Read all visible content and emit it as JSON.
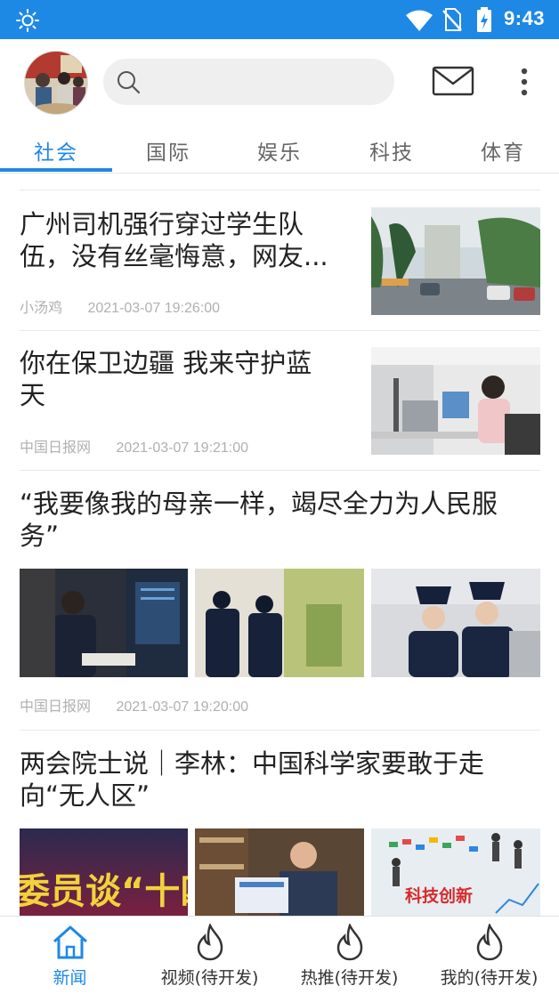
{
  "status_bar": {
    "time": "9:43",
    "icons": [
      "brightness-icon",
      "wifi-icon",
      "no-sim-icon",
      "battery-charging-icon"
    ]
  },
  "header": {
    "search": {
      "placeholder": ""
    },
    "icons": [
      "search-icon",
      "mail-icon",
      "more-vert-icon"
    ]
  },
  "tabs": [
    {
      "label": "社会",
      "active": true
    },
    {
      "label": "国际",
      "active": false
    },
    {
      "label": "娱乐",
      "active": false
    },
    {
      "label": "科技",
      "active": false
    },
    {
      "label": "体育",
      "active": false
    }
  ],
  "articles": [
    {
      "title_line1": "广州司机强行穿过学生队",
      "title_line2": "伍，没有丝毫悔意，网友...",
      "source": "小汤鸡",
      "time": "2021-03-07 19:26:00"
    },
    {
      "title_line1": "你在保卫边疆 我来守护蓝",
      "title_line2": "天",
      "source": "中国日报网",
      "time": "2021-03-07 19:21:00"
    },
    {
      "title_line1": "“我要像我的母亲一样，竭尽全力为人民服",
      "title_line2": "务”",
      "source": "中国日报网",
      "time": "2021-03-07 19:20:00"
    },
    {
      "title_line1": "两会院士说｜李林：中国科学家要敢于走",
      "title_line2": "向“无人区”",
      "image_text_1": "委员谈“十四",
      "image_text_3": "科技创新"
    }
  ],
  "bottom_nav": [
    {
      "label": "新闻",
      "icon": "home-icon",
      "active": true
    },
    {
      "label": "视频(待开发)",
      "icon": "flame-icon",
      "active": false
    },
    {
      "label": "热推(待开发)",
      "icon": "flame-icon",
      "active": false
    },
    {
      "label": "我的(待开发)",
      "icon": "flame-icon",
      "active": false
    }
  ],
  "colors": {
    "accent": "#1e88e5",
    "text": "#222222",
    "meta": "#b0b0b0"
  }
}
